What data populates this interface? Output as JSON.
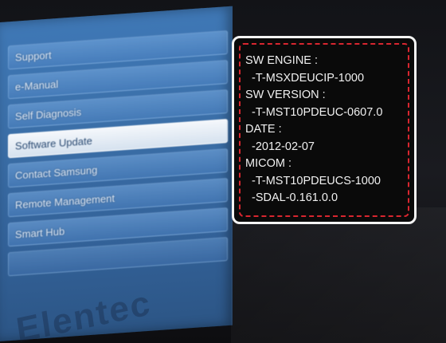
{
  "menu": {
    "items": [
      {
        "label": "Support",
        "selected": false
      },
      {
        "label": "e-Manual",
        "selected": false
      },
      {
        "label": "Self Diagnosis",
        "selected": false
      },
      {
        "label": "Software Update",
        "selected": true
      },
      {
        "label": "Contact Samsung",
        "selected": false
      },
      {
        "label": "Remote Management",
        "selected": false
      },
      {
        "label": "Smart Hub",
        "selected": false
      },
      {
        "label": "",
        "selected": false
      }
    ]
  },
  "watermark": "Elentec",
  "info": {
    "lines": [
      {
        "text": "SW ENGINE :",
        "indent": false
      },
      {
        "text": "-T-MSXDEUCIP-1000",
        "indent": true
      },
      {
        "text": "SW VERSION :",
        "indent": false
      },
      {
        "text": "-T-MST10PDEUC-0607.0",
        "indent": true
      },
      {
        "text": "DATE :",
        "indent": false
      },
      {
        "text": "-2012-02-07",
        "indent": true
      },
      {
        "text": "MICOM :",
        "indent": false
      },
      {
        "text": "-T-MST10PDEUCS-1000",
        "indent": true
      },
      {
        "text": "-SDAL-0.161.0.0",
        "indent": true
      }
    ]
  },
  "colors": {
    "panel_blue": "#3b6fa8",
    "highlight_dash": "#d8262f",
    "box_border": "#f4f4f4"
  }
}
